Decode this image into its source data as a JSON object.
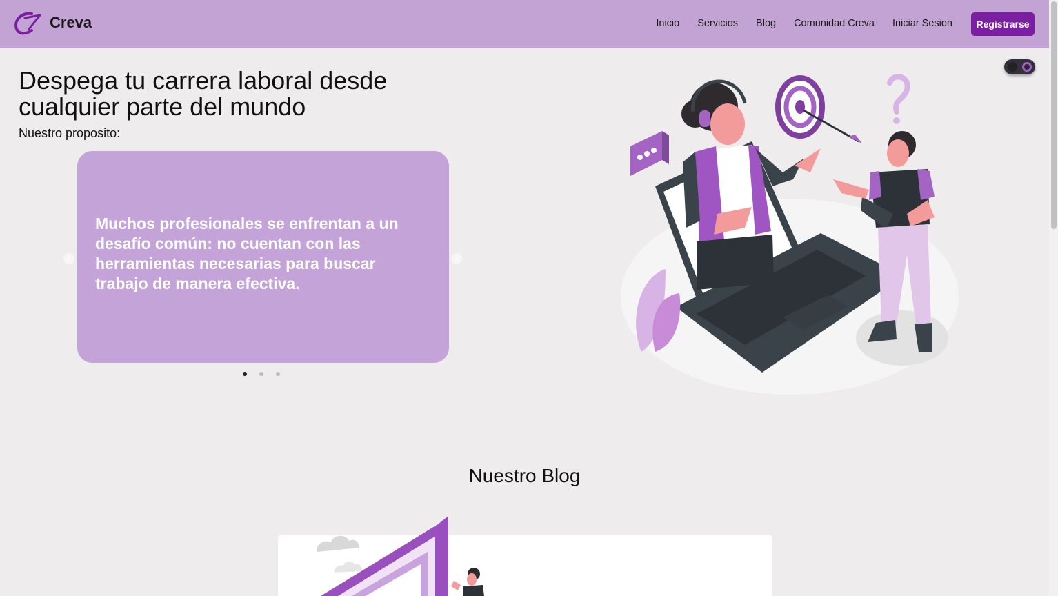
{
  "brand": {
    "name": "Creva"
  },
  "nav": {
    "links": [
      "Inicio",
      "Servicios",
      "Blog",
      "Comunidad Creva",
      "Iniciar Sesion"
    ],
    "register_label": "Registrarse"
  },
  "hero": {
    "title": "Despega tu carrera laboral desde cualquier parte del mundo",
    "subtitle": "Nuestro proposito:",
    "carousel": {
      "text": "Muchos profesionales se enfrentan a un desafío común: no cuentan con las herramientas necesarias para buscar trabajo de manera efectiva.",
      "prev_icon": "chevron-left-icon",
      "next_icon": "chevron-right-icon",
      "slides": 3,
      "active_slide": 1
    }
  },
  "blog": {
    "title": "Nuestro Blog"
  },
  "colors": {
    "header_bg": "#c3a3d3",
    "accent": "#7a1fa2",
    "card_bg": "#c3a3d8",
    "page_bg": "#eeeced"
  }
}
